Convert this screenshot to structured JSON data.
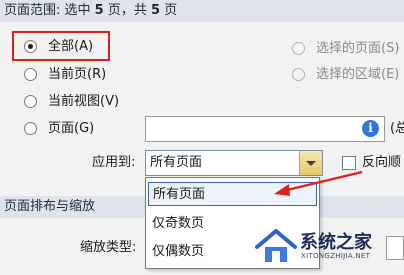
{
  "page_range": {
    "label": "页面范围: 选中 ",
    "selected_count": "5",
    "mid": " 页，共 ",
    "total_count": "5",
    "suffix": " 页"
  },
  "options": {
    "all": "全部(A)",
    "current_page": "当前页(R)",
    "current_view": "当前视图(V)",
    "pages": "页面(G)",
    "selected_pages": "选择的页面(S)",
    "selected_area": "选择的区域(E)",
    "pages_hint": "(总"
  },
  "apply_to": {
    "label": "应用到:",
    "selected": "所有页面",
    "reverse_label": "反向顺"
  },
  "dropdown_items": [
    "所有页面",
    "仅奇数页",
    "仅偶数页"
  ],
  "layout_section": {
    "title": "页面排布与缩放",
    "zoom_type_label": "缩放类型:"
  },
  "watermark": {
    "title": "系统之家",
    "url": "XITONGZHIJIA.NET"
  },
  "colors": {
    "highlight": "#e02020",
    "arrow": "#e02020",
    "info_icon": "#2f78d8",
    "section_bg": "#dfe3ea"
  }
}
